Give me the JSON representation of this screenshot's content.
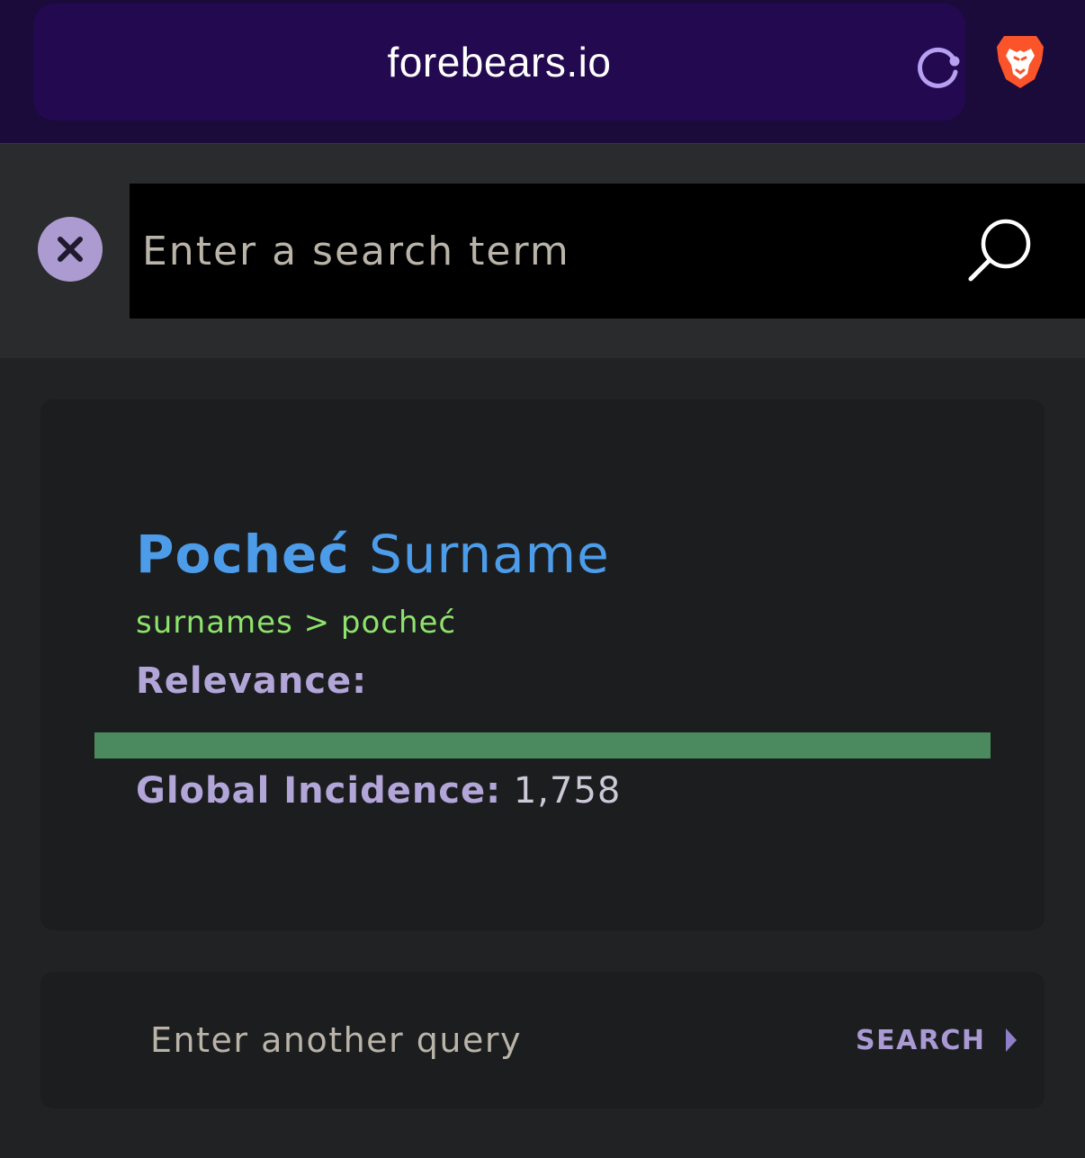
{
  "browser": {
    "url": "forebears.io",
    "reload_icon": "reload-icon",
    "shield_icon": "brave-lion-icon"
  },
  "search": {
    "placeholder": "Enter a search term",
    "close_icon": "close-icon",
    "search_icon": "search-icon"
  },
  "result": {
    "name": "Pocheć",
    "kind": "Surname",
    "breadcrumb": "surnames > pocheć",
    "relevance_label": "Relevance:",
    "relevance_fraction": 1.0,
    "incidence_label": "Global Incidence:",
    "incidence_value": "1,758"
  },
  "query": {
    "placeholder": "Enter another query",
    "submit_label": "SEARCH",
    "submit_icon": "chevron-right-icon"
  },
  "colors": {
    "browser_bg": "#1a0b3b",
    "accent_purple": "#ab9bd0",
    "title_blue": "#4c9ce9",
    "breadcrumb_green": "#8de36b",
    "relevance_green": "#4a8a5e"
  }
}
